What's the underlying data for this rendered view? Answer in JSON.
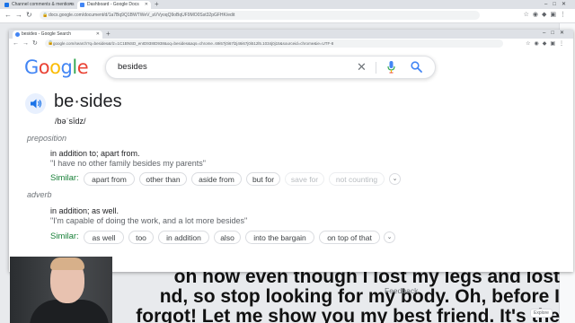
{
  "outer_browser": {
    "tabs": [
      {
        "label": "Channel comments & mentions"
      },
      {
        "label": "Dashboard - Google Docs"
      }
    ],
    "new_tab": "+",
    "url": "docs.google.com/document/d/1a7Bq9Q1BWTWeV_aVVyoqQ9oBqUF9MO0Sst32pGFHK/edit"
  },
  "popup_browser": {
    "tab_title": "besides - Google Search",
    "url": "google.com/search?q=besides&rlz=1C1BNSD_enID938ID938&oq=besides&aqs=chrome..69i57j0i67l2j46i67j0i512l5.1034j0j15&sourceid=chrome&ie=UTF-8"
  },
  "search": {
    "logo": "Google",
    "query": "besides"
  },
  "dictionary": {
    "headword": "be·sides",
    "phonetic": "/bəˈsīdz/",
    "similar_label": "Similar:",
    "feedback": "Feedback",
    "senses": [
      {
        "pos": "preposition",
        "definition": "in addition to; apart from.",
        "example": "\"I have no other family besides my parents\"",
        "similar": [
          "apart from",
          "other than",
          "aside from",
          "but for"
        ],
        "similar_disabled": [
          "save for",
          "not counting"
        ]
      },
      {
        "pos": "adverb",
        "definition": "in addition; as well.",
        "example": "\"I'm capable of doing the work, and a lot more besides\"",
        "similar": [
          "as well",
          "too",
          "in addition",
          "also",
          "into the bargain",
          "on top of that"
        ],
        "similar_disabled": []
      }
    ]
  },
  "doc": {
    "lines": [
      "oh how even though I lost my legs and lost",
      "nd, so stop looking for my body. Oh, before I",
      "forgot! Let me show you my best friend. It's the"
    ],
    "explore": "Explore"
  },
  "colors": {
    "google_blue": "#4285f4",
    "google_red": "#ea4335",
    "google_yellow": "#fbbc05",
    "google_green": "#34a853",
    "similar_green": "#188038"
  }
}
